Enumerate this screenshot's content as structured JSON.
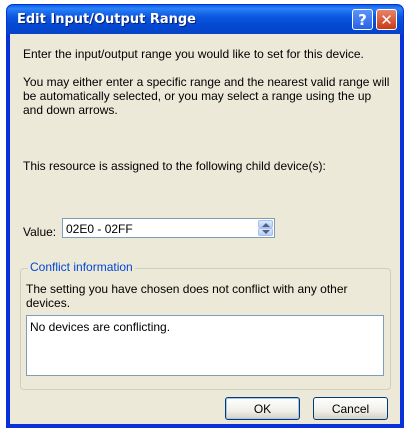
{
  "window": {
    "title": "Edit Input/Output Range",
    "help_glyph": "?",
    "close_glyph": "✕"
  },
  "body": {
    "intro": "Enter the input/output range you would like to set for this device.",
    "explain": "You may either enter a specific range and the nearest valid range will be automatically selected, or you may select a range using the up and down arrows.",
    "assigned": "This resource is assigned to the following child device(s):"
  },
  "value": {
    "label": "Value:",
    "current": "02E0 - 02FF"
  },
  "conflict": {
    "legend": "Conflict information",
    "message": "The setting you have chosen does not conflict with any other devices.",
    "list_text": "No devices are conflicting."
  },
  "buttons": {
    "ok": "OK",
    "cancel": "Cancel"
  },
  "colors": {
    "titlebar": "#0b58e0",
    "client_bg": "#ece9d8",
    "group_legend": "#0046d5",
    "close_button": "#c83b17"
  }
}
